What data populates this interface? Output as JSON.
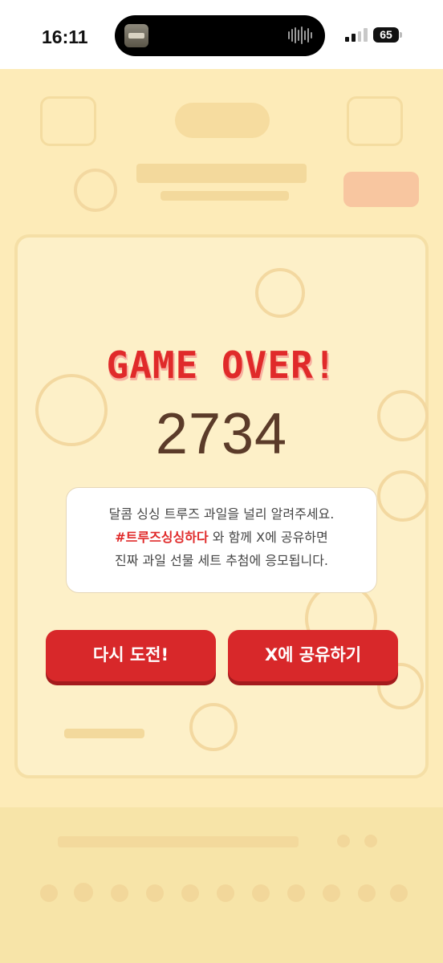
{
  "status_bar": {
    "time": "16:11",
    "battery": "65"
  },
  "game_over": {
    "title": "GAME OVER!",
    "score": "2734",
    "message": {
      "line1": "달콤 싱싱 트루즈 과일을 널리 알려주세요.",
      "hashtag": "#트루즈싱싱하다",
      "line2_rest": " 와 함께 X에 공유하면",
      "line3": "진짜 과일 선물 세트 추첨에 응모됩니다."
    },
    "buttons": {
      "retry": "다시 도전!",
      "share": "X에 공유하기"
    }
  },
  "colors": {
    "accent_red": "#d8282a",
    "title_red": "#e02a2a",
    "score_brown": "#5b3b29",
    "overlay_cream": "#fdebb8"
  },
  "icons": [
    "music-thumbnail-icon",
    "audio-waveform-icon",
    "cellular-signal-icon",
    "battery-icon"
  ]
}
